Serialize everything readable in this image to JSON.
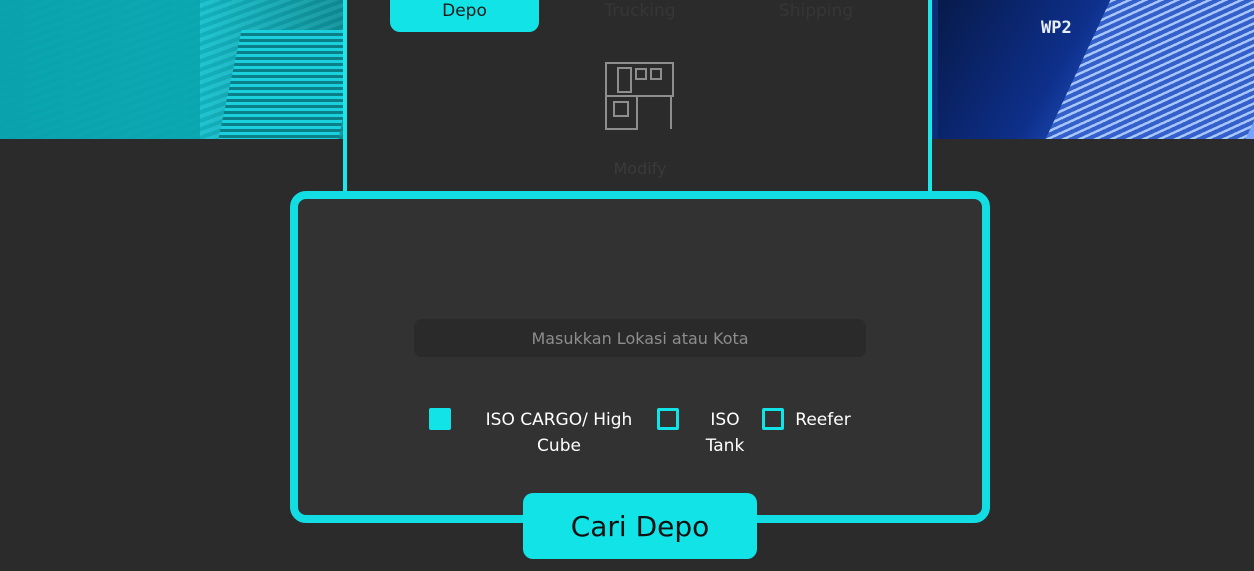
{
  "tabs": [
    {
      "label": "Depo",
      "active": true
    },
    {
      "label": "Trucking",
      "active": false
    },
    {
      "label": "Shipping",
      "active": false
    }
  ],
  "modify": {
    "label": "Modify",
    "icon": "depot-building-icon"
  },
  "hero": {
    "container_text": "WP2"
  },
  "search": {
    "placeholder": "Masukkan Lokasi atau Kota",
    "value": ""
  },
  "options": [
    {
      "label_line1": "ISO CARGO/ High",
      "label_line2": "Cube",
      "checked": true
    },
    {
      "label_line1": "ISO",
      "label_line2": "Tank",
      "checked": false
    },
    {
      "label_line1": "Reefer",
      "label_line2": "",
      "checked": false
    }
  ],
  "submit": {
    "label": "Cari Depo"
  },
  "colors": {
    "accent": "#12e3e6",
    "background": "#2b2b2b",
    "card": "#323232"
  }
}
